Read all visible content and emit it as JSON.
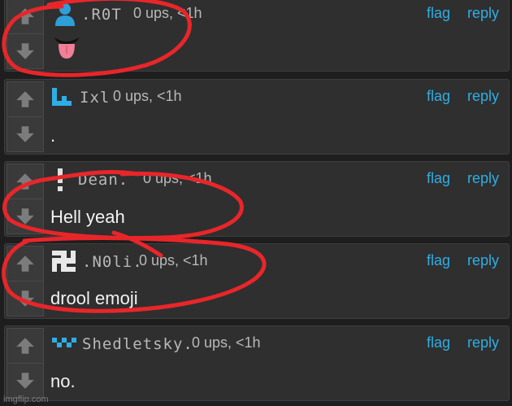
{
  "actions": {
    "flag_label": "flag",
    "reply_label": "reply"
  },
  "comments": [
    {
      "user": ".R0T",
      "meta": "0 ups, <1h",
      "text": "",
      "avatar_icon": "person-icon"
    },
    {
      "user": "Ixl",
      "meta": "0 ups, <1h",
      "text": ".",
      "avatar_icon": "pixel-l-icon"
    },
    {
      "user": "Dean.",
      "meta": "0 ups, <1h",
      "text": "Hell yeah",
      "avatar_icon": "exclamation-icon"
    },
    {
      "user": ".N0li.",
      "meta": "0 ups, <1h",
      "text": "drool emoji",
      "avatar_icon": "pixel-swastika-icon"
    },
    {
      "user": "Shedletsky.",
      "meta": "0 ups, <1h",
      "text": "no.",
      "avatar_icon": "pixel-face-icon"
    }
  ],
  "colors": {
    "link": "#2eaee5",
    "annotation": "#e8262a",
    "panel": "#2f2f2f"
  },
  "watermark": "imgflip.com"
}
